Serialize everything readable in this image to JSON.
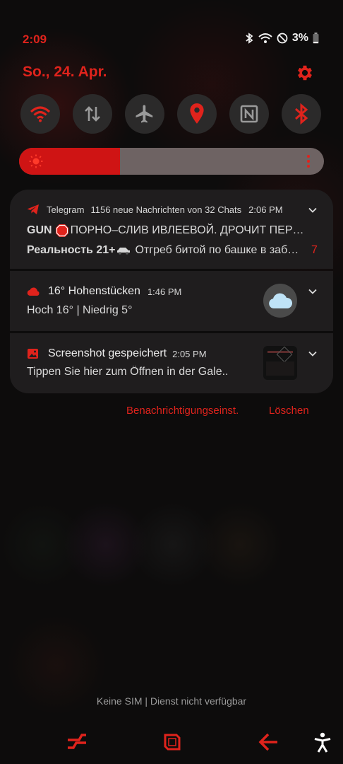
{
  "status": {
    "time": "2:09",
    "battery": "3%",
    "icons": [
      "bluetooth-icon",
      "wifi-icon",
      "dnd-icon",
      "battery-icon"
    ]
  },
  "header": {
    "date": "So., 24. Apr."
  },
  "quick_tiles": [
    {
      "name": "wifi",
      "icon": "wifi-icon",
      "active": true
    },
    {
      "name": "mobile-data",
      "icon": "data-arrows-icon",
      "active": false
    },
    {
      "name": "airplane",
      "icon": "airplane-icon",
      "active": false
    },
    {
      "name": "location",
      "icon": "location-icon",
      "active": true
    },
    {
      "name": "nfc",
      "icon": "nfc-icon",
      "active": false
    },
    {
      "name": "bluetooth",
      "icon": "bluetooth-icon",
      "active": true
    }
  ],
  "brightness": {
    "level": 0.33
  },
  "notifications": [
    {
      "app": "Telegram",
      "summary": "1156 neue Nachrichten von 32 Chats",
      "time": "2:06 PM",
      "line1_prefix": "GUN ",
      "line1": "ПОРНО–СЛИВ ИВЛЕЕВОЙ. ДРОЧИТ ПЕР…",
      "line2_prefix": "Реальность 21+ ",
      "line2": "Отгреб битой по башке в заб…",
      "badge": "7"
    },
    {
      "title": "16° Hohenstücken",
      "time": "1:46 PM",
      "text": "Hoch 16° | Niedrig 5°"
    },
    {
      "title": "Screenshot gespeichert",
      "time": "2:05 PM",
      "text": "Tippen Sie hier zum Öffnen in der Gale.."
    }
  ],
  "actions": {
    "settings_label": "Benachrichtigungseinst.",
    "clear_label": "Löschen"
  },
  "footer": {
    "sim_text": "Keine SIM | Dienst nicht verfügbar"
  },
  "colors": {
    "accent": "#e0231c",
    "tile_bg": "#2b2a2a",
    "card_bg": "#1f1d1e"
  }
}
